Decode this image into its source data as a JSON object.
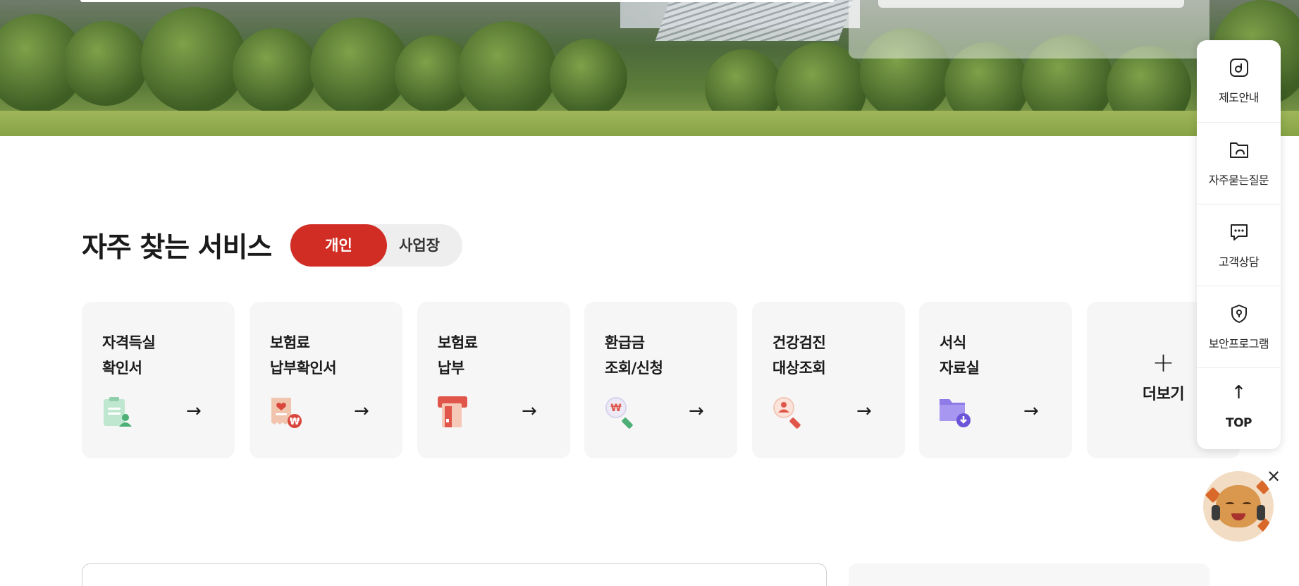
{
  "section": {
    "title": "자주 찾는 서비스",
    "toggle": {
      "active": "개인",
      "inactive": "사업장"
    }
  },
  "services": [
    {
      "label": "자격득실\n확인서",
      "icon": "certificate-person-icon"
    },
    {
      "label": "보험료\n납부확인서",
      "icon": "receipt-won-icon"
    },
    {
      "label": "보험료\n납부",
      "icon": "card-payment-icon"
    },
    {
      "label": "환급금\n조회/신청",
      "icon": "search-won-icon"
    },
    {
      "label": "건강검진\n대상조회",
      "icon": "search-person-icon"
    },
    {
      "label": "서식\n자료실",
      "icon": "folder-download-icon"
    }
  ],
  "more": {
    "label": "더보기"
  },
  "arrow": "→",
  "plus": "+",
  "quick_menu": [
    {
      "label": "제도안내",
      "icon": "policy-guide-icon"
    },
    {
      "label": "자주묻는질문",
      "icon": "faq-folder-icon"
    },
    {
      "label": "고객상담",
      "icon": "chat-bubble-icon"
    },
    {
      "label": "보안프로그램",
      "icon": "shield-icon"
    }
  ],
  "top_button": {
    "label": "TOP",
    "glyph": "↑"
  },
  "chatbot": {
    "close_glyph": "✕"
  },
  "colors": {
    "accent": "#d22d24",
    "card_bg": "#f6f6f6",
    "toggle_bg": "#eeeeee"
  }
}
